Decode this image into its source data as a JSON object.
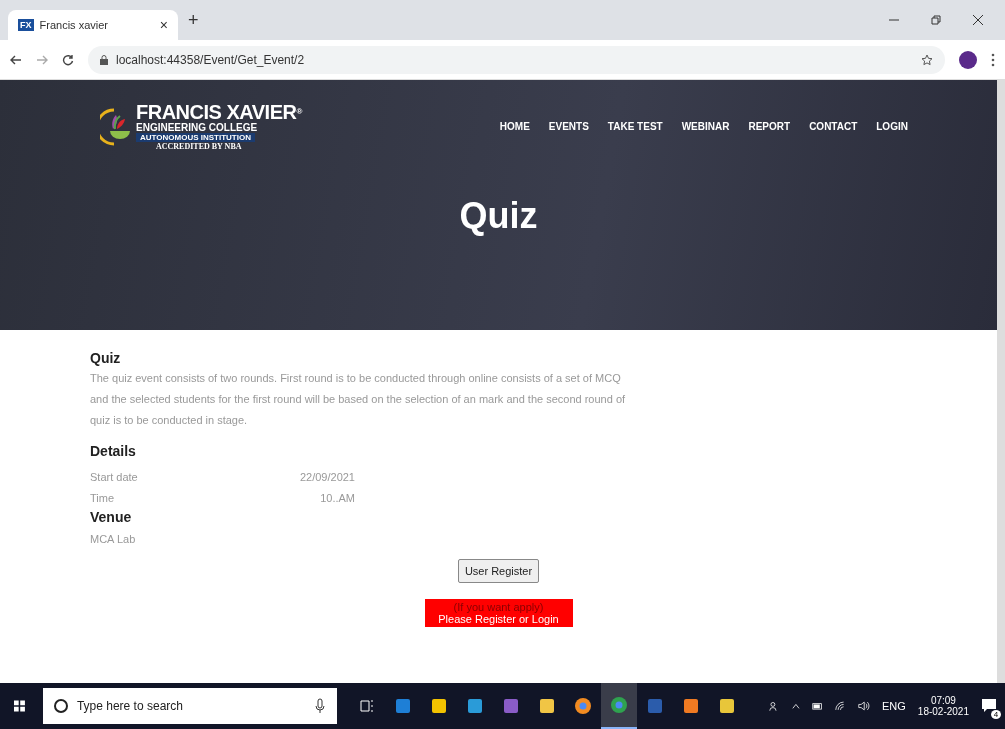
{
  "browser": {
    "tab": {
      "favicon": "FX",
      "title": "Francis xavier",
      "close": "×"
    },
    "new_tab": "+",
    "url": "localhost:44358/Event/Get_Event/2"
  },
  "header": {
    "logo": {
      "name": "FRANCIS XAVIER",
      "sub": "ENGINEERING COLLEGE",
      "band": "AUTONOMOUS INSTITUTION",
      "accred": "ACCREDITED BY NBA",
      "reg": "®"
    },
    "nav": [
      "HOME",
      "EVENTS",
      "TAKE TEST",
      "WEBINAR",
      "REPORT",
      "CONTACT",
      "LOGIN"
    ],
    "title": "Quiz"
  },
  "event": {
    "title": "Quiz",
    "description": "The quiz event consists of two rounds. First round is to be conducted through online consists of a set of MCQ and the selected students for the first round will be based on the selection of an mark and the second round of quiz is to be conducted in stage.",
    "details_heading": "Details",
    "details": [
      {
        "label": "Start date",
        "value": "22/09/2021"
      },
      {
        "label": "Time",
        "value": "10..AM"
      }
    ],
    "venue_heading": "Venue",
    "venue": "MCA Lab"
  },
  "register_button": "User Register",
  "notice": {
    "line1": "(If you want apply)",
    "line2": "Please Register or Login"
  },
  "taskbar": {
    "search_placeholder": "Type here to search",
    "apps": [
      {
        "kind": "taskview",
        "selected": false
      },
      {
        "kind": "edge",
        "selected": false
      },
      {
        "kind": "store",
        "selected": false
      },
      {
        "kind": "mail",
        "selected": false
      },
      {
        "kind": "vs",
        "selected": false
      },
      {
        "kind": "files",
        "selected": false
      },
      {
        "kind": "firefox",
        "selected": false
      },
      {
        "kind": "chrome",
        "selected": true
      },
      {
        "kind": "word",
        "selected": false
      },
      {
        "kind": "tool",
        "selected": false
      },
      {
        "kind": "snip",
        "selected": false
      }
    ],
    "language": "ENG",
    "time": "07:09",
    "date": "18-02-2021",
    "notifications": "4"
  }
}
